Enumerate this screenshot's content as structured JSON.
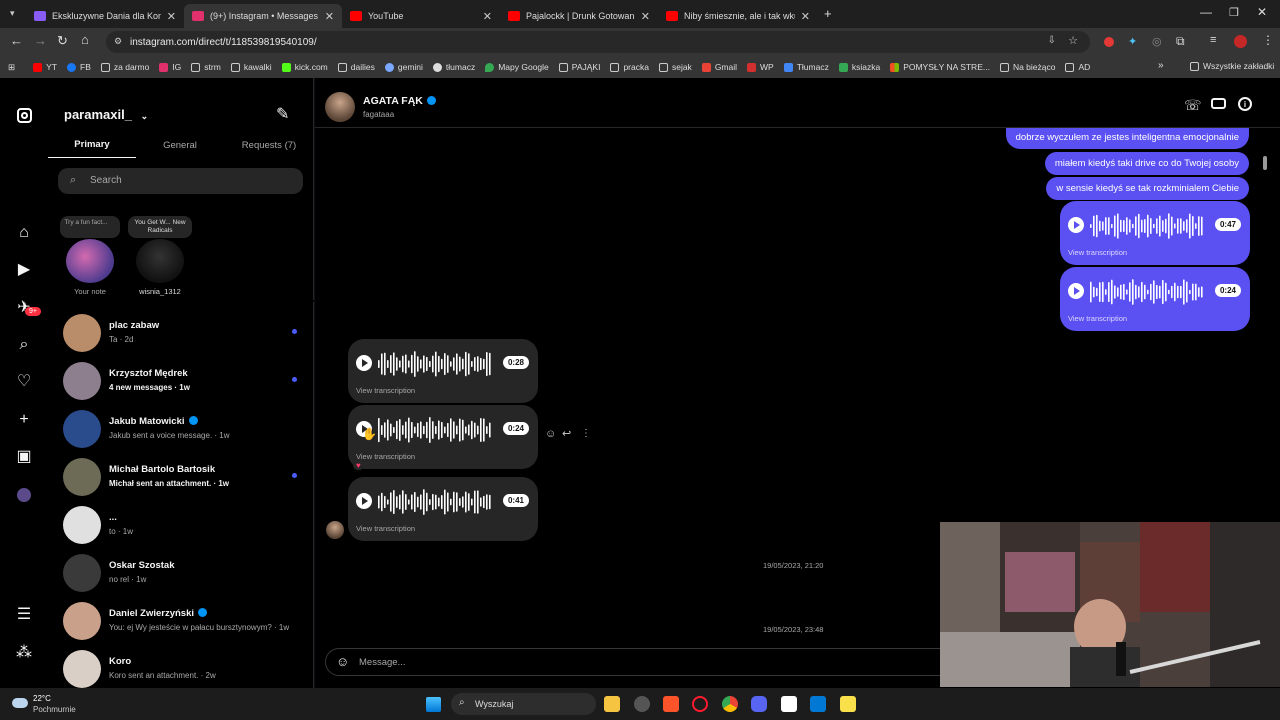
{
  "browser": {
    "tabs": [
      {
        "title": "Ekskluzywne Dania dla Koneserów",
        "color": "#8a5cf6",
        "active": false
      },
      {
        "title": "(9+) Instagram • Messages",
        "color": "#e1306c",
        "active": true
      },
      {
        "title": "YouTube",
        "color": "#ff0000",
        "active": false
      },
      {
        "title": "Pajalockk | Drunk Gotowanie z A",
        "color": "#ff0000",
        "active": false
      },
      {
        "title": "Niby śmiesznie, ale i tak wkurza",
        "color": "#ff0000",
        "active": false
      }
    ],
    "url": "instagram.com/direct/t/118539819540109/",
    "bookmarks": [
      "YT",
      "FB",
      "za darmo",
      "IG",
      "strm",
      "kawalki",
      "kick.com",
      "dailies",
      "gemini",
      "tłumacz",
      "Mapy Google",
      "PAJĄKI",
      "pracka",
      "sejak",
      "Gmail",
      "WP",
      "Tłumacz",
      "ksiazka",
      "POMYSŁY NA STRE...",
      "Na bieżąco",
      "AD"
    ],
    "all_bookmarks": "Wszystkie zakładki"
  },
  "sidebar": {
    "username": "paramaxil_",
    "tabs": [
      "Primary",
      "General",
      "Requests (7)"
    ],
    "search_placeholder": "Search",
    "notification_badge": "9+",
    "notes": [
      {
        "bubble": "Try a fun fact...",
        "label": "Your note"
      },
      {
        "bubble": "You Get W... New Radicals",
        "label": "wisnia_1312"
      }
    ],
    "conversations": [
      {
        "name": "plac zabaw",
        "preview": "Ta · 2d",
        "unread": true,
        "bold": false,
        "verified": false,
        "color": "#b98c6a"
      },
      {
        "name": "Krzysztof Mędrek",
        "preview": "4 new messages · 1w",
        "unread": true,
        "bold": true,
        "verified": false,
        "color": "#8e7f8f"
      },
      {
        "name": "Jakub Matowicki",
        "preview": "Jakub sent a voice message. · 1w",
        "unread": false,
        "bold": false,
        "verified": true,
        "color": "#2a4b8c"
      },
      {
        "name": "Michał Bartolo Bartosik",
        "preview": "Michał sent an attachment. · 1w",
        "unread": true,
        "bold": true,
        "verified": false,
        "color": "#6d6a55"
      },
      {
        "name": "...",
        "preview": "to · 1w",
        "unread": false,
        "bold": false,
        "verified": false,
        "color": "#e0e0e0"
      },
      {
        "name": "Oskar Szostak",
        "preview": "no rel · 1w",
        "unread": false,
        "bold": false,
        "verified": false,
        "color": "#3a3a3a"
      },
      {
        "name": "Daniel Zwierzyński",
        "preview": "You: ej Wy jesteście w pałacu bursztynowym? · 1w",
        "unread": false,
        "bold": false,
        "verified": true,
        "color": "#c9a08a"
      },
      {
        "name": "Koro",
        "preview": "Koro sent an attachment. · 2w",
        "unread": false,
        "bold": false,
        "verified": false,
        "color": "#d9cfc6"
      }
    ]
  },
  "chat": {
    "contact_name": "AGATA FĄK",
    "contact_handle": "fagataaa",
    "outgoing_texts": [
      "dobrze wyczułem ze jestes inteligentna emocjonalnie",
      "miałem kiedyś taki drive co do Twojej osoby",
      "w sensie kiedyś se tak rozkminialem Ciebie"
    ],
    "outgoing_voice": [
      {
        "duration": "0:47"
      },
      {
        "duration": "0:24"
      }
    ],
    "incoming_voice": [
      {
        "duration": "0:28"
      },
      {
        "duration": "0:24"
      },
      {
        "duration": "0:41"
      }
    ],
    "view_transcription": "View transcription",
    "reaction": "♥",
    "timestamps": [
      "19/05/2023, 21:20",
      "19/05/2023, 23:48"
    ],
    "message_placeholder": "Message..."
  },
  "taskbar": {
    "weather_temp": "22°C",
    "weather_desc": "Pochmurnie",
    "search_label": "Wyszukaj"
  }
}
